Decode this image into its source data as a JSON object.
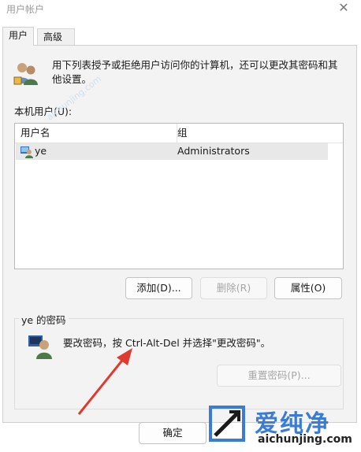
{
  "window": {
    "title": "用户帐户",
    "close_glyph": "✕"
  },
  "tabs": [
    {
      "label": "用户",
      "selected": true
    },
    {
      "label": "高级",
      "selected": false
    }
  ],
  "intro": {
    "text": "用下列表授予或拒绝用户访问你的计算机，还可以更改其密码和其他设置。",
    "icon": "users-icon"
  },
  "users_list": {
    "label": "本机用户(U):",
    "columns": [
      "用户名",
      "组"
    ],
    "rows": [
      {
        "name": "ye",
        "group": "Administrators",
        "icon": "user-icon"
      }
    ]
  },
  "buttons": {
    "add": "添加(D)...",
    "remove": "删除(R)",
    "properties": "属性(O)",
    "reset_password": "重置密码(P)...",
    "ok": "确定"
  },
  "password_section": {
    "legend": "ye 的密码",
    "text": "要改密码，按 Ctrl-Alt-Del 并选择\"更改密码\"。",
    "icon": "user-key-icon"
  },
  "watermark": {
    "brand": "爱纯净",
    "url": "aichunjing.com"
  },
  "colors": {
    "panel_bg": "#f3f3f3",
    "selected_row": "#e8e8e8",
    "annotation_arrow": "#e03a2f",
    "watermark_blue": "#3a7bd5"
  }
}
